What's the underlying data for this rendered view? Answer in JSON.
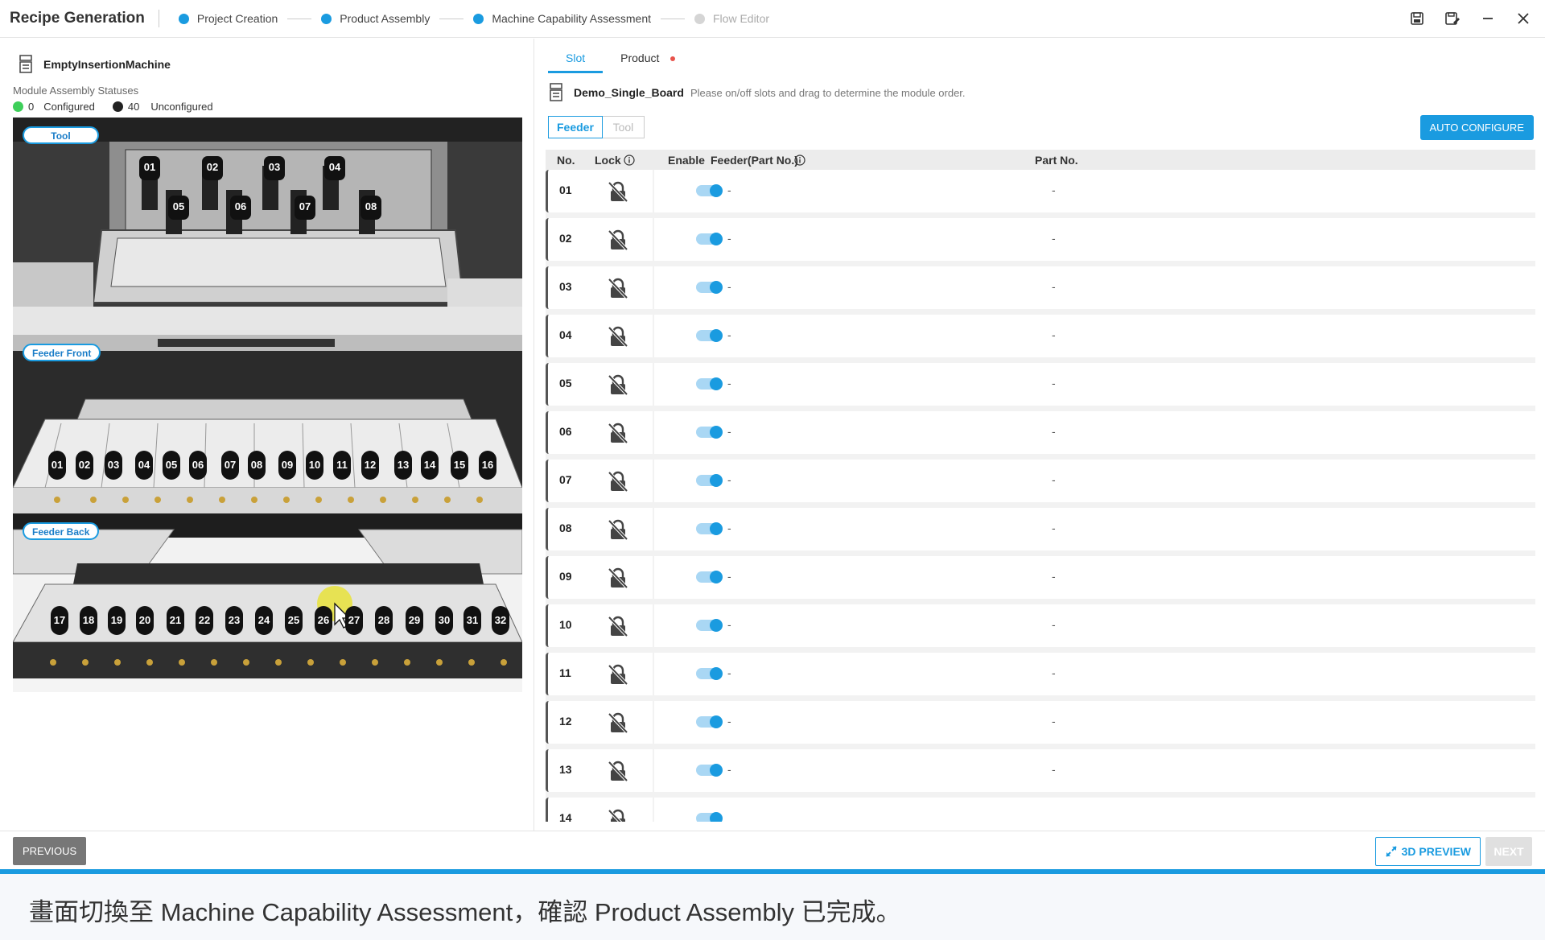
{
  "header": {
    "title": "Recipe Generation",
    "steps": [
      {
        "label": "Project Creation",
        "done": true
      },
      {
        "label": "Product Assembly",
        "done": true
      },
      {
        "label": "Machine Capability Assessment",
        "done": true
      },
      {
        "label": "Flow Editor",
        "done": false
      }
    ],
    "window_icons": [
      "save-icon",
      "save-as-icon",
      "minimize-icon",
      "close-icon"
    ]
  },
  "left": {
    "machine_name": "EmptyInsertionMachine",
    "statuses_title": "Module Assembly Statuses",
    "configured_count": "0",
    "configured_label": "Configured",
    "unconfigured_count": "40",
    "unconfigured_label": "Unconfigured",
    "colors": {
      "configured": "#3ecf5a",
      "unconfigured": "#222222"
    },
    "views": {
      "tool": {
        "label": "Tool",
        "top_slots": [
          "01",
          "02",
          "03",
          "04"
        ],
        "bottom_slots": [
          "05",
          "06",
          "07",
          "08"
        ]
      },
      "feeder_front": {
        "label": "Feeder Front",
        "slots": [
          "01",
          "02",
          "03",
          "04",
          "05",
          "06",
          "07",
          "08",
          "09",
          "10",
          "11",
          "12",
          "13",
          "14",
          "15",
          "16"
        ]
      },
      "feeder_back": {
        "label": "Feeder Back",
        "slots": [
          "17",
          "18",
          "19",
          "20",
          "21",
          "22",
          "23",
          "24",
          "25",
          "26",
          "27",
          "28",
          "29",
          "30",
          "31",
          "32"
        ]
      }
    }
  },
  "right": {
    "tabs": [
      {
        "label": "Slot"
      },
      {
        "label": "Product"
      }
    ],
    "board_name": "Demo_Single_Board",
    "board_hint": "Please on/off slots and drag to determine the module order.",
    "segment": {
      "feeder": "Feeder",
      "tool": "Tool"
    },
    "auto_configure": "AUTO CONFIGURE",
    "columns": {
      "no": "No.",
      "lock": "Lock",
      "enable": "Enable",
      "feeder": "Feeder(Part No.)",
      "part": "Part No."
    },
    "rows": [
      {
        "no": "01",
        "feeder": "-",
        "part": "-",
        "enabled": true
      },
      {
        "no": "02",
        "feeder": "-",
        "part": "-",
        "enabled": true
      },
      {
        "no": "03",
        "feeder": "-",
        "part": "-",
        "enabled": true
      },
      {
        "no": "04",
        "feeder": "-",
        "part": "-",
        "enabled": true
      },
      {
        "no": "05",
        "feeder": "-",
        "part": "-",
        "enabled": true
      },
      {
        "no": "06",
        "feeder": "-",
        "part": "-",
        "enabled": true
      },
      {
        "no": "07",
        "feeder": "-",
        "part": "-",
        "enabled": true
      },
      {
        "no": "08",
        "feeder": "-",
        "part": "-",
        "enabled": true
      },
      {
        "no": "09",
        "feeder": "-",
        "part": "-",
        "enabled": true
      },
      {
        "no": "10",
        "feeder": "-",
        "part": "-",
        "enabled": true
      },
      {
        "no": "11",
        "feeder": "-",
        "part": "-",
        "enabled": true
      },
      {
        "no": "12",
        "feeder": "-",
        "part": "-",
        "enabled": true
      },
      {
        "no": "13",
        "feeder": "-",
        "part": "-",
        "enabled": true
      },
      {
        "no": "14",
        "feeder": "",
        "part": "",
        "enabled": true
      }
    ]
  },
  "footer": {
    "previous": "PREVIOUS",
    "preview": "3D PREVIEW",
    "next": "NEXT"
  },
  "caption": "畫面切換至 Machine Capability Assessment，確認 Product Assembly 已完成。"
}
